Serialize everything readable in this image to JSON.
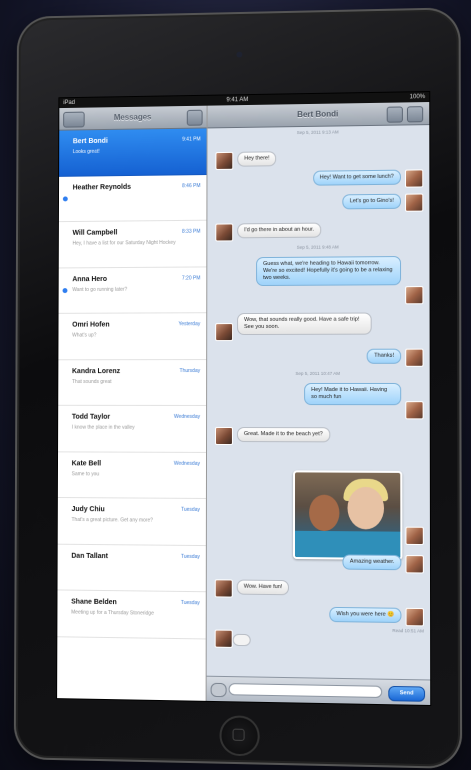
{
  "status_bar": {
    "carrier": "iPad",
    "time": "9:41 AM",
    "battery": "100%"
  },
  "master": {
    "title": "Messages",
    "conversations": [
      {
        "name": "Bert Bondi",
        "preview": "Looks great!",
        "date": "9:41 PM",
        "unread": false,
        "selected": true
      },
      {
        "name": "Heather Reynolds",
        "preview": "",
        "date": "8:46 PM",
        "unread": true,
        "selected": false
      },
      {
        "name": "Will Campbell",
        "preview": "Hey, I have a list for our Saturday Night Hockey",
        "date": "8:33 PM",
        "unread": false,
        "selected": false
      },
      {
        "name": "Anna Hero",
        "preview": "Want to go running later?",
        "date": "7:20 PM",
        "unread": true,
        "selected": false
      },
      {
        "name": "Omri Hofen",
        "preview": "What's up?",
        "date": "Yesterday",
        "unread": false,
        "selected": false
      },
      {
        "name": "Kandra Lorenz",
        "preview": "That sounds great",
        "date": "Thursday",
        "unread": false,
        "selected": false
      },
      {
        "name": "Todd Taylor",
        "preview": "I know the place in the valley",
        "date": "Wednesday",
        "unread": false,
        "selected": false
      },
      {
        "name": "Kate Bell",
        "preview": "Same to you",
        "date": "Wednesday",
        "unread": false,
        "selected": false
      },
      {
        "name": "Judy Chiu",
        "preview": "That's a great picture. Get any more?",
        "date": "Tuesday",
        "unread": false,
        "selected": false
      },
      {
        "name": "Dan Tallant",
        "preview": "",
        "date": "Tuesday",
        "unread": false,
        "selected": false
      },
      {
        "name": "Shane Belden",
        "preview": "Meeting up for a Thursday Stoneridge",
        "date": "Tuesday",
        "unread": false,
        "selected": false
      }
    ]
  },
  "detail": {
    "title": "Bert Bondi",
    "timestamps": [
      "Sep 5, 2011 9:13 AM",
      "Sep 5, 2011 9:48 AM",
      "Sep 5, 2011 10:47 AM"
    ],
    "messages": [
      {
        "dir": "in",
        "text": "Hey there!"
      },
      {
        "dir": "out",
        "text": "Hey! Want to get some lunch?"
      },
      {
        "dir": "out",
        "text": "Let's go to Gino's!"
      },
      {
        "dir": "in",
        "text": "I'd go there in about an hour."
      },
      {
        "dir": "out",
        "text": "Guess what, we're heading to Hawaii tomorrow. We're so excited! Hopefully it's going to be a relaxing two weeks."
      },
      {
        "dir": "in",
        "text": "Wow, that sounds really good. Have a safe trip! See you soon."
      },
      {
        "dir": "out",
        "text": "Thanks!"
      },
      {
        "dir": "out",
        "text": "Hey! Made it to Hawaii. Having so much fun"
      },
      {
        "dir": "in",
        "text": "Great. Made it to the beach yet?"
      },
      {
        "dir": "out",
        "text": "Amazing weather."
      },
      {
        "dir": "in",
        "text": "Wow. Have fun!"
      },
      {
        "dir": "out",
        "text": "Wish you were here 😊"
      }
    ],
    "delivered": "Read 10:51 AM",
    "input_placeholder": "",
    "send_label": "Send"
  }
}
